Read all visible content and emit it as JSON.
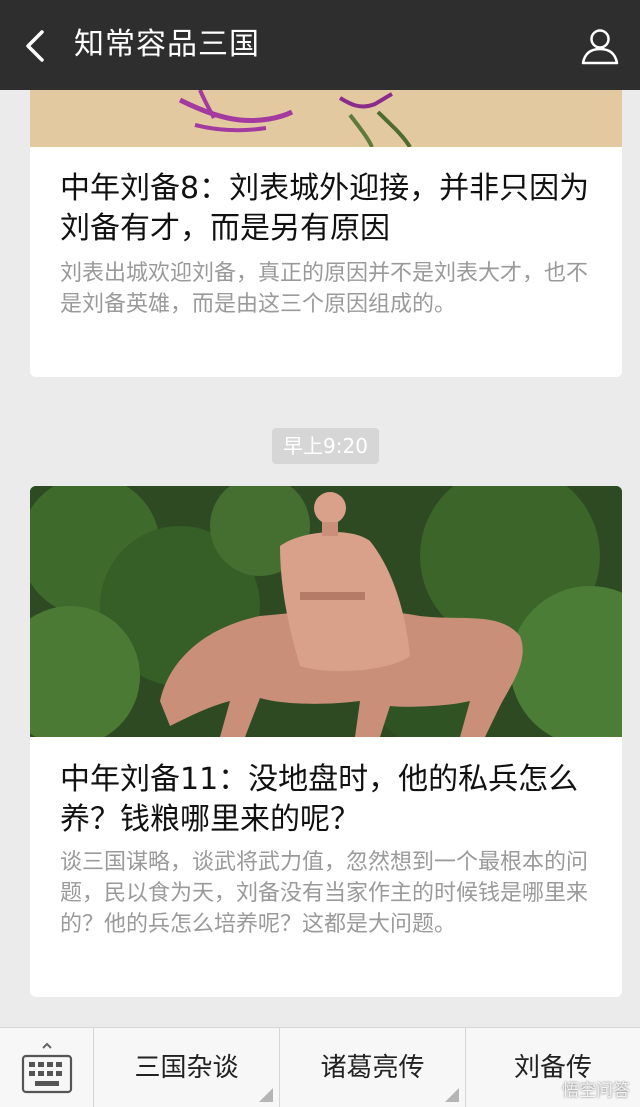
{
  "header": {
    "title": "知常容品三国",
    "back_icon": "chevron-left-icon",
    "profile_icon": "person-icon"
  },
  "articles": [
    {
      "title": "中年刘备8：刘表城外迎接，并非只因为刘备有才，而是另有原因",
      "description": "刘表出城欢迎刘备，真正的原因并不是刘表大才，也不是刘备英雄，而是由这三个原因组成的。"
    },
    {
      "title": "中年刘备11：没地盘时，他的私兵怎么养？钱粮哪里来的呢？",
      "description": "谈三国谋略，谈武将武力值，忽然想到一个最根本的问题，民以食为天，刘备没有当家作主的时候钱是哪里来的？他的兵怎么培养呢？这都是大问题。"
    }
  ],
  "timestamp": "早上9:20",
  "bottom_menu": {
    "keyboard_icon": "keyboard-icon",
    "items": [
      {
        "label": "三国杂谈"
      },
      {
        "label": "诸葛亮传"
      },
      {
        "label": "刘备传"
      }
    ]
  },
  "watermark": "悟空问答",
  "colors": {
    "header_bg": "#2e2e2e",
    "page_bg": "#ebebeb",
    "desc_text": "#9a9a9a",
    "timestamp_bg": "#d6d6d6"
  }
}
